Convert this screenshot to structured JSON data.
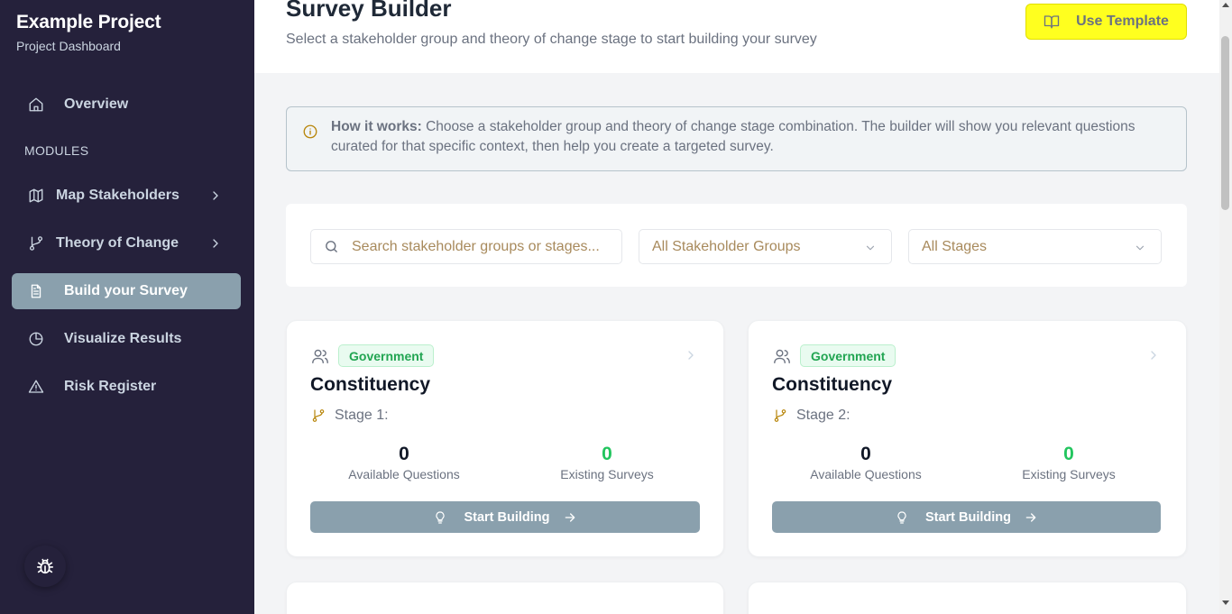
{
  "sidebar": {
    "project_title": "Example Project",
    "project_subtitle": "Project Dashboard",
    "overview_label": "Overview",
    "modules_label": "MODULES",
    "items": [
      {
        "label": "Map Stakeholders",
        "icon": "map-icon",
        "has_submenu": true
      },
      {
        "label": "Theory of Change",
        "icon": "git-branch-icon",
        "has_submenu": true
      },
      {
        "label": "Build your Survey",
        "icon": "file-text-icon",
        "active": true
      },
      {
        "label": "Visualize Results",
        "icon": "pie-chart-icon"
      },
      {
        "label": "Risk Register",
        "icon": "alert-triangle-icon"
      }
    ],
    "bug_icon": "bug-icon"
  },
  "header": {
    "title": "Survey Builder",
    "subtitle": "Select a stakeholder group and theory of change stage to start building your survey",
    "template_button": "Use Template"
  },
  "info": {
    "bold": "How it works:",
    "text": " Choose a stakeholder group and theory of change stage combination. The builder will show you relevant questions curated for that specific context, then help you create a targeted survey."
  },
  "filters": {
    "search_placeholder": "Search stakeholder groups or stages...",
    "group_select": "All Stakeholder Groups",
    "stage_select": "All Stages"
  },
  "cards": [
    {
      "badge": "Government",
      "title": "Constituency",
      "stage": "Stage 1:",
      "available_questions": "0",
      "available_label": "Available Questions",
      "existing_surveys": "0",
      "existing_label": "Existing Surveys",
      "button": "Start Building"
    },
    {
      "badge": "Government",
      "title": "Constituency",
      "stage": "Stage 2:",
      "available_questions": "0",
      "available_label": "Available Questions",
      "existing_surveys": "0",
      "existing_label": "Existing Surveys",
      "button": "Start Building"
    }
  ],
  "colors": {
    "sidebar_bg": "#25213b",
    "active_item": "#8aa0ad",
    "accent_yellow": "#ffff1f",
    "badge_green": "#22a552"
  }
}
